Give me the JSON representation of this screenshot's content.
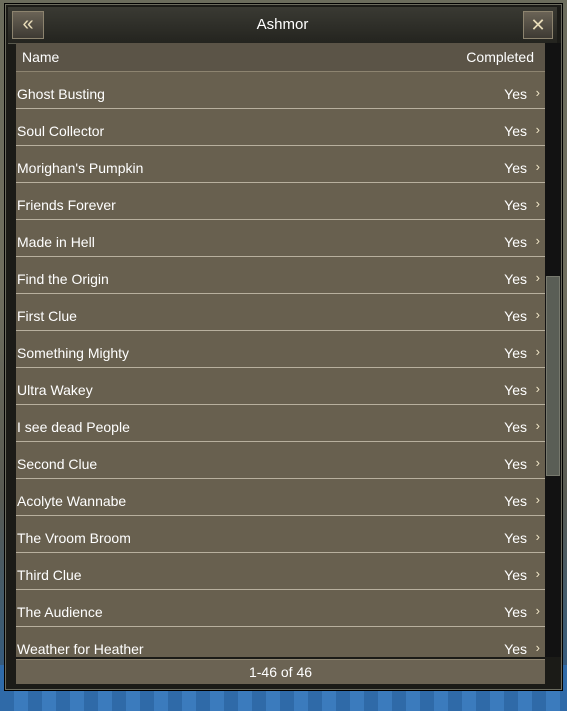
{
  "window": {
    "title": "Ashmor"
  },
  "table": {
    "headers": {
      "name": "Name",
      "completed": "Completed"
    },
    "rows": [
      {
        "name": "Ghost Busting",
        "completed": "Yes"
      },
      {
        "name": "Soul Collector",
        "completed": "Yes"
      },
      {
        "name": "Morighan's Pumpkin",
        "completed": "Yes"
      },
      {
        "name": "Friends Forever",
        "completed": "Yes"
      },
      {
        "name": "Made in Hell",
        "completed": "Yes"
      },
      {
        "name": "Find the Origin",
        "completed": "Yes"
      },
      {
        "name": "First Clue",
        "completed": "Yes"
      },
      {
        "name": "Something Mighty",
        "completed": "Yes"
      },
      {
        "name": "Ultra Wakey",
        "completed": "Yes"
      },
      {
        "name": "I see dead People",
        "completed": "Yes"
      },
      {
        "name": "Second Clue",
        "completed": "Yes"
      },
      {
        "name": "Acolyte Wannabe",
        "completed": "Yes"
      },
      {
        "name": "The Vroom Broom",
        "completed": "Yes"
      },
      {
        "name": "Third Clue",
        "completed": "Yes"
      },
      {
        "name": "The Audience",
        "completed": "Yes"
      },
      {
        "name": "Weather for Heather",
        "completed": "Yes"
      }
    ]
  },
  "footer": {
    "pagination": "1-46 of 46"
  },
  "icons": {
    "back": "chevron-left-double-icon",
    "close": "close-x-icon",
    "row_arrow": "chevron-right-icon"
  }
}
